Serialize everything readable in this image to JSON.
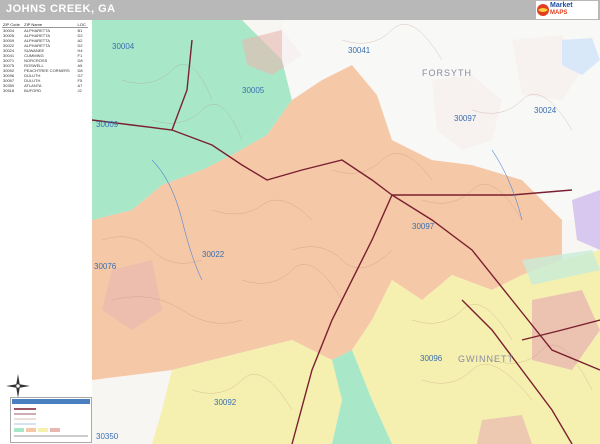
{
  "title": "JOHNS CREEK, GA",
  "logo": {
    "line1": "Market",
    "line2": "MAPS"
  },
  "zip_table": {
    "headers": [
      "ZIP Code",
      "ZIP Name",
      "LOC"
    ],
    "rows": [
      [
        "30004",
        "ALPHARETTA",
        "B1"
      ],
      [
        "30005",
        "ALPHARETTA",
        "D2"
      ],
      [
        "30009",
        "ALPHARETTA",
        "A2"
      ],
      [
        "30022",
        "ALPHARETTA",
        "D2"
      ],
      [
        "30024",
        "SUWANEE",
        "H4"
      ],
      [
        "30041",
        "CUMMING",
        "F1"
      ],
      [
        "30071",
        "NORCROSS",
        "D8"
      ],
      [
        "30075",
        "ROSWELL",
        "A5"
      ],
      [
        "30092",
        "PEACHTREE CORNERS",
        "D8"
      ],
      [
        "30096",
        "DULUTH",
        "G7"
      ],
      [
        "30097",
        "DULUTH",
        "F5"
      ],
      [
        "30350",
        "ATLANTA",
        "A7"
      ],
      [
        "30518",
        "BUFORD",
        "J2"
      ]
    ]
  },
  "map_labels": {
    "zips": [
      {
        "text": "30004"
      },
      {
        "text": "30041"
      },
      {
        "text": "30005"
      },
      {
        "text": "30009"
      },
      {
        "text": "30097"
      },
      {
        "text": "30024"
      },
      {
        "text": "30097"
      },
      {
        "text": "30022"
      },
      {
        "text": "30076"
      },
      {
        "text": "30096"
      },
      {
        "text": "30092"
      },
      {
        "text": "30350"
      }
    ],
    "places": [
      {
        "text": "FORSYTH"
      },
      {
        "text": "GWINNETT"
      }
    ]
  },
  "colors": {
    "orange_zone": "#f5c8a8",
    "green_zone": "#a8e8c8",
    "yellow_zone": "#f5f0b0",
    "pink_zone": "#e8b8b0",
    "white_zone": "#f8f8f8",
    "road_major": "#7a2030",
    "zip_label": "#3a6fb0"
  }
}
